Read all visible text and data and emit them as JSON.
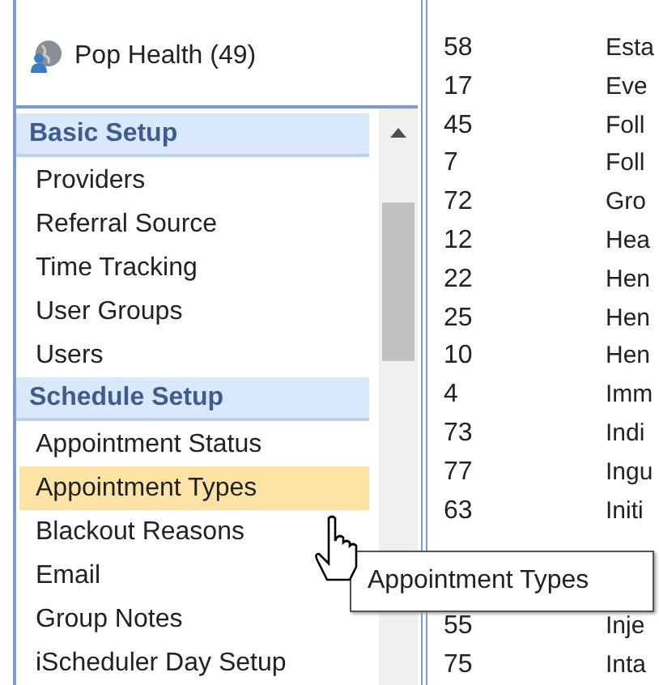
{
  "top_items": [
    {
      "label": "Pop Health (49)"
    }
  ],
  "setup_menu": [
    {
      "kind": "header",
      "label": "Basic Setup"
    },
    {
      "kind": "item",
      "label": "Providers",
      "selected": false
    },
    {
      "kind": "item",
      "label": "Referral Source",
      "selected": false
    },
    {
      "kind": "item",
      "label": "Time Tracking",
      "selected": false
    },
    {
      "kind": "item",
      "label": "User Groups",
      "selected": false
    },
    {
      "kind": "item",
      "label": "Users",
      "selected": false
    },
    {
      "kind": "header",
      "label": "Schedule Setup"
    },
    {
      "kind": "item",
      "label": "Appointment Status",
      "selected": false
    },
    {
      "kind": "item",
      "label": "Appointment Types",
      "selected": true
    },
    {
      "kind": "item",
      "label": "Blackout Reasons",
      "selected": false
    },
    {
      "kind": "item",
      "label": "Email",
      "selected": false
    },
    {
      "kind": "item",
      "label": "Group Notes",
      "selected": false
    },
    {
      "kind": "item",
      "label": "iScheduler Day Setup",
      "selected": false
    }
  ],
  "table": {
    "rows": [
      {
        "column_1": "58",
        "column_2": "Esta"
      },
      {
        "column_1": "17",
        "column_2": "Eve"
      },
      {
        "column_1": "45",
        "column_2": "Foll"
      },
      {
        "column_1": "7",
        "column_2": "Foll"
      },
      {
        "column_1": "72",
        "column_2": "Gro"
      },
      {
        "column_1": "12",
        "column_2": "Hea"
      },
      {
        "column_1": "22",
        "column_2": "Hen"
      },
      {
        "column_1": "25",
        "column_2": "Hen"
      },
      {
        "column_1": "10",
        "column_2": "Hen"
      },
      {
        "column_1": "4",
        "column_2": "Imm"
      },
      {
        "column_1": "73",
        "column_2": "Indi"
      },
      {
        "column_1": "77",
        "column_2": "Ingu"
      },
      {
        "column_1": "63",
        "column_2": "Initi"
      },
      {
        "column_1": "55",
        "column_2": "Inje"
      },
      {
        "column_1": "75",
        "column_2": "Inta"
      }
    ]
  },
  "tooltip": {
    "text": "Appointment Types"
  }
}
